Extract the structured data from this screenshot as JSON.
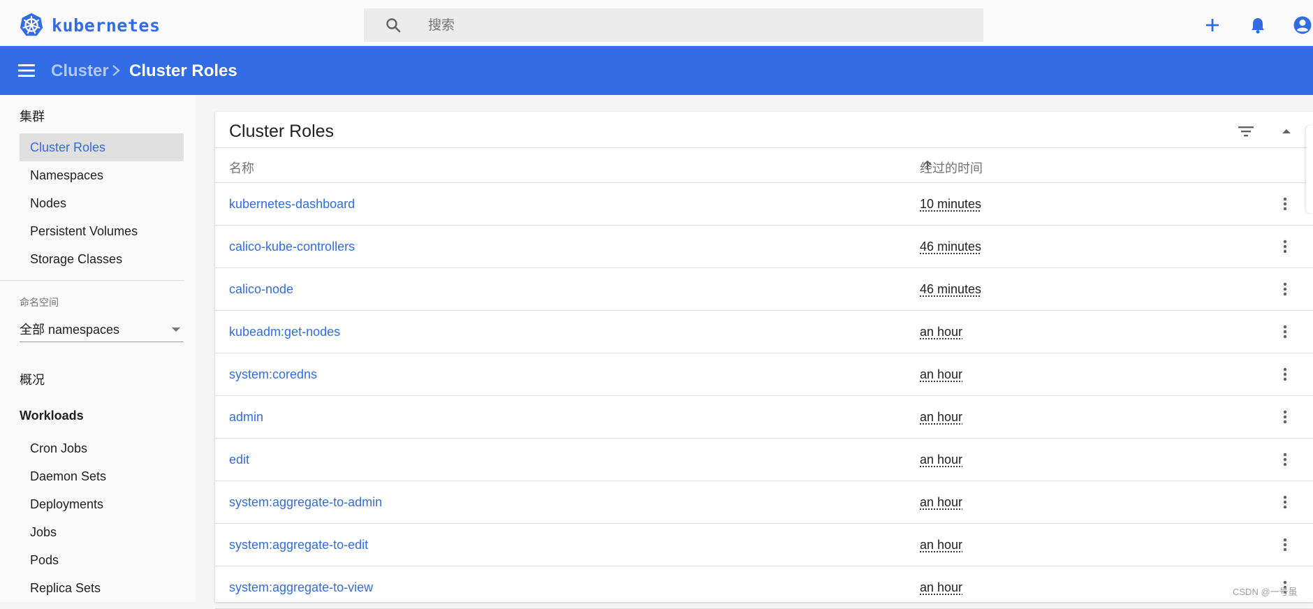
{
  "brand": {
    "name": "kubernetes",
    "color": "#326ce5"
  },
  "search": {
    "placeholder": "搜索",
    "icon": "search-icon"
  },
  "top_actions": [
    {
      "name": "add-icon",
      "glyph": "+"
    },
    {
      "name": "bell-icon",
      "glyph": "bell"
    },
    {
      "name": "account-icon",
      "glyph": "account"
    }
  ],
  "breadcrumb": {
    "parent": "Cluster",
    "current": "Cluster Roles"
  },
  "sidebar": {
    "cluster_heading": "集群",
    "cluster_items": [
      {
        "label": "Cluster Roles",
        "active": true
      },
      {
        "label": "Namespaces",
        "active": false
      },
      {
        "label": "Nodes",
        "active": false
      },
      {
        "label": "Persistent Volumes",
        "active": false
      },
      {
        "label": "Storage Classes",
        "active": false
      }
    ],
    "namespace_label": "命名空间",
    "namespace_value": "全部 namespaces",
    "overview": "概况",
    "workloads_heading": "Workloads",
    "workload_items": [
      "Cron Jobs",
      "Daemon Sets",
      "Deployments",
      "Jobs",
      "Pods",
      "Replica Sets"
    ]
  },
  "card": {
    "title": "Cluster Roles",
    "columns": {
      "name": "名称",
      "age": "经过的时间"
    },
    "rows": [
      {
        "name": "kubernetes-dashboard",
        "age": "10 minutes"
      },
      {
        "name": "calico-kube-controllers",
        "age": "46 minutes"
      },
      {
        "name": "calico-node",
        "age": "46 minutes"
      },
      {
        "name": "kubeadm:get-nodes",
        "age": "an hour"
      },
      {
        "name": "system:coredns",
        "age": "an hour"
      },
      {
        "name": "admin",
        "age": "an hour"
      },
      {
        "name": "edit",
        "age": "an hour"
      },
      {
        "name": "system:aggregate-to-admin",
        "age": "an hour"
      },
      {
        "name": "system:aggregate-to-edit",
        "age": "an hour"
      },
      {
        "name": "system:aggregate-to-view",
        "age": "an hour"
      }
    ]
  },
  "watermark": "CSDN @一号虽"
}
